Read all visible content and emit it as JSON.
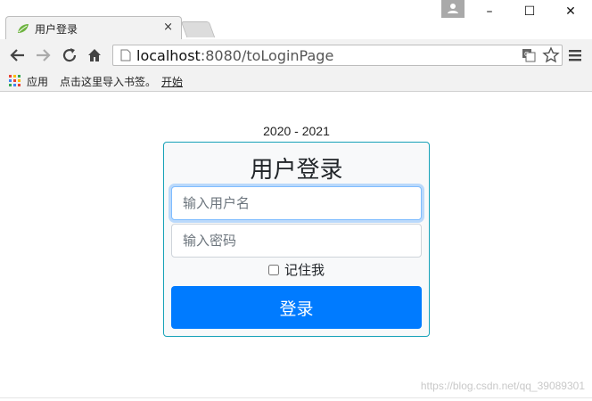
{
  "browser": {
    "tab_title": "用户登录",
    "tab_close": "×",
    "window_controls": {
      "minimize": "–",
      "maximize": "☐",
      "close": "✕"
    },
    "address_host": "localhost",
    "address_rest": ":8080/toLoginPage",
    "bookmarks": {
      "apps": "应用",
      "import": "点击这里导入书签。",
      "start": "开始"
    },
    "icons": [
      "spring-leaf-favicon-icon",
      "back-arrow-icon",
      "forward-arrow-icon",
      "reload-icon",
      "home-icon",
      "page-icon",
      "translate-icon",
      "star-icon",
      "menu-icon",
      "apps-grid-icon",
      "profile-icon"
    ]
  },
  "page": {
    "year_range": "2020 - 2021",
    "title": "用户登录",
    "username_placeholder": "输入用户名",
    "password_placeholder": "输入密码",
    "remember_label": "记住我",
    "login_button": "登录",
    "watermark": "https://blog.csdn.net/qq_39089301"
  },
  "colors": {
    "primary": "#007bff",
    "card_border": "#17a2b8",
    "card_bg": "#f8f9fa"
  }
}
